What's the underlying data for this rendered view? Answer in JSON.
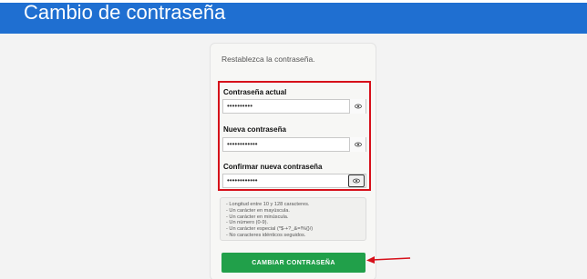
{
  "header": {
    "title": "Cambio de contraseña",
    "color": "#1f6fd1"
  },
  "card": {
    "subtitle": "Restablezca la contraseña.",
    "fields": [
      {
        "label": "Contraseña actual",
        "value": "••••••••••",
        "icon": "eye-icon"
      },
      {
        "label": "Nueva contraseña",
        "value": "••••••••••••",
        "icon": "eye-icon"
      },
      {
        "label": "Confirmar nueva contraseña",
        "value": "••••••••••••",
        "icon": "eye-icon"
      }
    ],
    "requirements": [
      "- Longitud entre 10 y 128 caracteres.",
      "- Un carácter en mayúscula.",
      "- Un carácter en minúscula.",
      "- Un número (0-9).",
      "- Un carácter especial (*$-+?_&=!%{}/)",
      "- No caracteres idénticos seguidos."
    ],
    "submit_label": "CAMBIAR CONTRASEÑA"
  },
  "colors": {
    "highlight": "#d6101a",
    "button": "#21a04a",
    "arrow": "#d6101a"
  }
}
